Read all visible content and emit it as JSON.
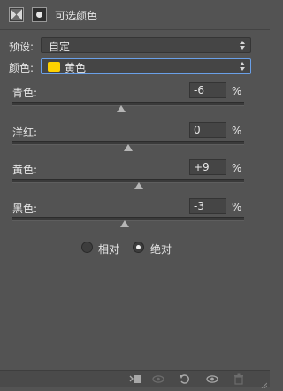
{
  "header": {
    "title": "可选颜色"
  },
  "preset": {
    "label": "预设:",
    "value": "自定"
  },
  "colors": {
    "label": "颜色:",
    "value": "黄色",
    "swatch_color": "#ffd200"
  },
  "sliders": [
    {
      "label": "青色:",
      "value": "-6",
      "percent": "%",
      "level": -0.06
    },
    {
      "label": "洋红:",
      "value": "0",
      "percent": "%",
      "level": 0
    },
    {
      "label": "黄色:",
      "value": "+9",
      "percent": "%",
      "level": 0.09
    },
    {
      "label": "黑色:",
      "value": "-3",
      "percent": "%",
      "level": -0.03
    }
  ],
  "method": {
    "options": [
      {
        "label": "相对",
        "selected": false
      },
      {
        "label": "绝对",
        "selected": true
      }
    ]
  },
  "toolbar": {
    "icons": [
      "clip-to-layer-icon",
      "eye-preview-icon",
      "reset-icon",
      "visibility-eye-icon",
      "trash-icon"
    ]
  }
}
